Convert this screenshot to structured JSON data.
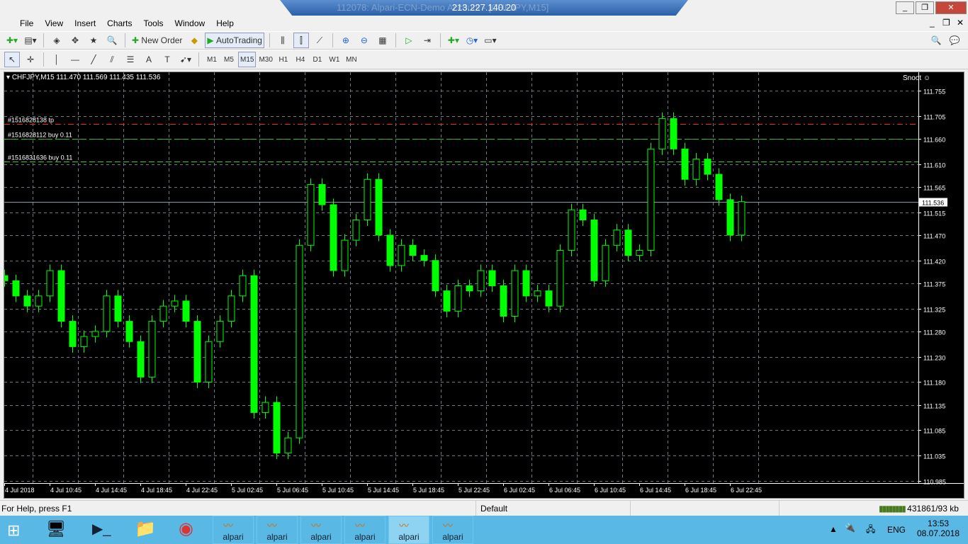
{
  "window": {
    "title": "112078: Alpari-ECN-Demo Account - [CHFJPY,M15]",
    "rdp_host": "213.227.140.20"
  },
  "menu": [
    "File",
    "View",
    "Insert",
    "Charts",
    "Tools",
    "Window",
    "Help"
  ],
  "toolbar": {
    "new_order": "New Order",
    "autotrading": "AutoTrading"
  },
  "timeframes": [
    "M1",
    "M5",
    "M15",
    "M30",
    "H1",
    "H4",
    "D1",
    "W1",
    "MN"
  ],
  "active_timeframe": "M15",
  "chart": {
    "header": "CHFJPY,M15  111.470 111.569 111.435 111.536",
    "brand": "Snoot",
    "current_price": "111.536",
    "orders": [
      {
        "label": "#1516828138 tp",
        "price": 111.69,
        "color": "#ff2020"
      },
      {
        "label": "#1516828112 buy 0.11",
        "price": 111.66,
        "color": "#20d020"
      },
      {
        "label": "#1516831636 buy 0.11",
        "price": 111.615,
        "color": "#20d020"
      }
    ]
  },
  "chart_data": {
    "type": "candlestick",
    "symbol": "CHFJPY",
    "timeframe": "M15",
    "ylim": [
      110.985,
      111.78
    ],
    "grid": true,
    "bull_color": "#00ff00",
    "bg": "#000000",
    "price_ticks": [
      "111.755",
      "111.705",
      "111.660",
      "111.610",
      "111.565",
      "111.515",
      "111.470",
      "111.420",
      "111.375",
      "111.325",
      "111.280",
      "111.230",
      "111.180",
      "111.135",
      "111.085",
      "111.035",
      "110.985"
    ],
    "time_ticks": [
      "4 Jul 2018",
      "4 Jul 10:45",
      "4 Jul 14:45",
      "4 Jul 18:45",
      "4 Jul 22:45",
      "5 Jul 02:45",
      "5 Jul 06:45",
      "5 Jul 10:45",
      "5 Jul 14:45",
      "5 Jul 18:45",
      "5 Jul 22:45",
      "6 Jul 02:45",
      "6 Jul 06:45",
      "6 Jul 10:45",
      "6 Jul 14:45",
      "6 Jul 18:45",
      "6 Jul 22:45"
    ],
    "closes": [
      111.38,
      111.35,
      111.33,
      111.35,
      111.4,
      111.3,
      111.25,
      111.27,
      111.28,
      111.35,
      111.3,
      111.26,
      111.19,
      111.3,
      111.33,
      111.34,
      111.3,
      111.18,
      111.26,
      111.3,
      111.35,
      111.39,
      111.12,
      111.14,
      111.04,
      111.07,
      111.45,
      111.57,
      111.53,
      111.4,
      111.46,
      111.5,
      111.58,
      111.47,
      111.41,
      111.45,
      111.43,
      111.42,
      111.36,
      111.32,
      111.37,
      111.36,
      111.4,
      111.37,
      111.31,
      111.4,
      111.35,
      111.36,
      111.33,
      111.44,
      111.52,
      111.5,
      111.38,
      111.45,
      111.48,
      111.43,
      111.44,
      111.64,
      111.7,
      111.64,
      111.58,
      111.62,
      111.59,
      111.54,
      111.47,
      111.536
    ]
  },
  "status": {
    "help": "For Help, press F1",
    "profile": "Default",
    "traffic": "431861/93 kb"
  },
  "taskbar": {
    "apps": [
      "alpari",
      "alpari",
      "alpari",
      "alpari",
      "alpari",
      "alpari"
    ],
    "lang": "ENG",
    "time": "13:53",
    "date": "08.07.2018"
  }
}
